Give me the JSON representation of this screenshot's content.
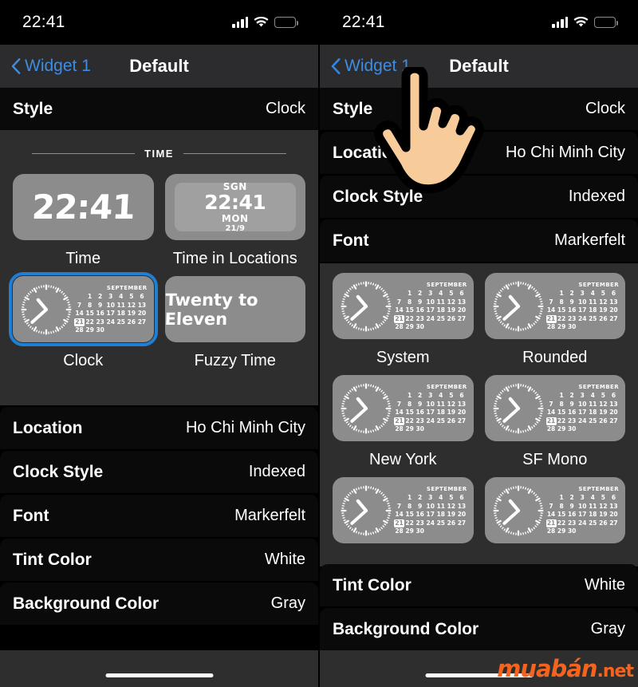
{
  "statusbar": {
    "time": "22:41",
    "signal": "cellular-bars-icon",
    "wifi": "wifi-icon",
    "battery": "battery-low-power-icon"
  },
  "left_phone": {
    "nav": {
      "back_label": "Widget 1",
      "title": "Default"
    },
    "style_row": {
      "label": "Style",
      "value": "Clock"
    },
    "section_header": "TIME",
    "options": [
      {
        "label": "Time",
        "kind": "digital",
        "value": "22:41",
        "selected": false
      },
      {
        "label": "Time in Locations",
        "kind": "location",
        "city": "SGN",
        "time": "22:41",
        "weekday": "MON",
        "date": "21/9",
        "selected": false
      },
      {
        "label": "Clock",
        "kind": "clockcal",
        "selected": true
      },
      {
        "label": "Fuzzy Time",
        "kind": "fuzzy",
        "value": "Twenty to Eleven",
        "selected": false
      }
    ],
    "rows": [
      {
        "label": "Location",
        "value": "Ho Chi Minh City"
      },
      {
        "label": "Clock Style",
        "value": "Indexed"
      },
      {
        "label": "Font",
        "value": "Markerfelt"
      },
      {
        "label": "Tint Color",
        "value": "White"
      },
      {
        "label": "Background Color",
        "value": "Gray"
      }
    ]
  },
  "right_phone": {
    "nav": {
      "back_label": "Widget 1",
      "title": "Default"
    },
    "rows_top": [
      {
        "label": "Style",
        "value": "Clock"
      },
      {
        "label": "Location",
        "value": "Ho Chi Minh City"
      },
      {
        "label": "Clock Style",
        "value": "Indexed"
      },
      {
        "label": "Font",
        "value": "Markerfelt"
      }
    ],
    "font_options": [
      {
        "label": "System"
      },
      {
        "label": "Rounded"
      },
      {
        "label": "New York"
      },
      {
        "label": "SF Mono"
      },
      {
        "label": ""
      },
      {
        "label": ""
      }
    ],
    "rows_bottom": [
      {
        "label": "Tint Color",
        "value": "White"
      },
      {
        "label": "Background Color",
        "value": "Gray"
      }
    ],
    "cursor": "pointing-hand-cursor"
  },
  "calendar": {
    "month": "SEPTEMBER",
    "today": "21",
    "weeks": [
      [
        "",
        "1",
        "2",
        "3",
        "4",
        "5",
        "6"
      ],
      [
        "7",
        "8",
        "9",
        "10",
        "11",
        "12",
        "13"
      ],
      [
        "14",
        "15",
        "16",
        "17",
        "18",
        "19",
        "20"
      ],
      [
        "21",
        "22",
        "23",
        "24",
        "25",
        "26",
        "27"
      ],
      [
        "28",
        "29",
        "30",
        "",
        "",
        "",
        ""
      ]
    ]
  },
  "watermark": {
    "main": "muabán",
    "suffix": ".net"
  },
  "colors": {
    "accent_blue": "#3f8ce0",
    "selection_blue": "#1f7fd4",
    "row_bg": "#0a0a0a",
    "panel_bg": "#2e2e2e",
    "nav_bg": "#2c2c2e",
    "tile_gray": "#8c8c8c",
    "battery_yellow": "#f5d020",
    "watermark_orange": "#f4641e"
  }
}
